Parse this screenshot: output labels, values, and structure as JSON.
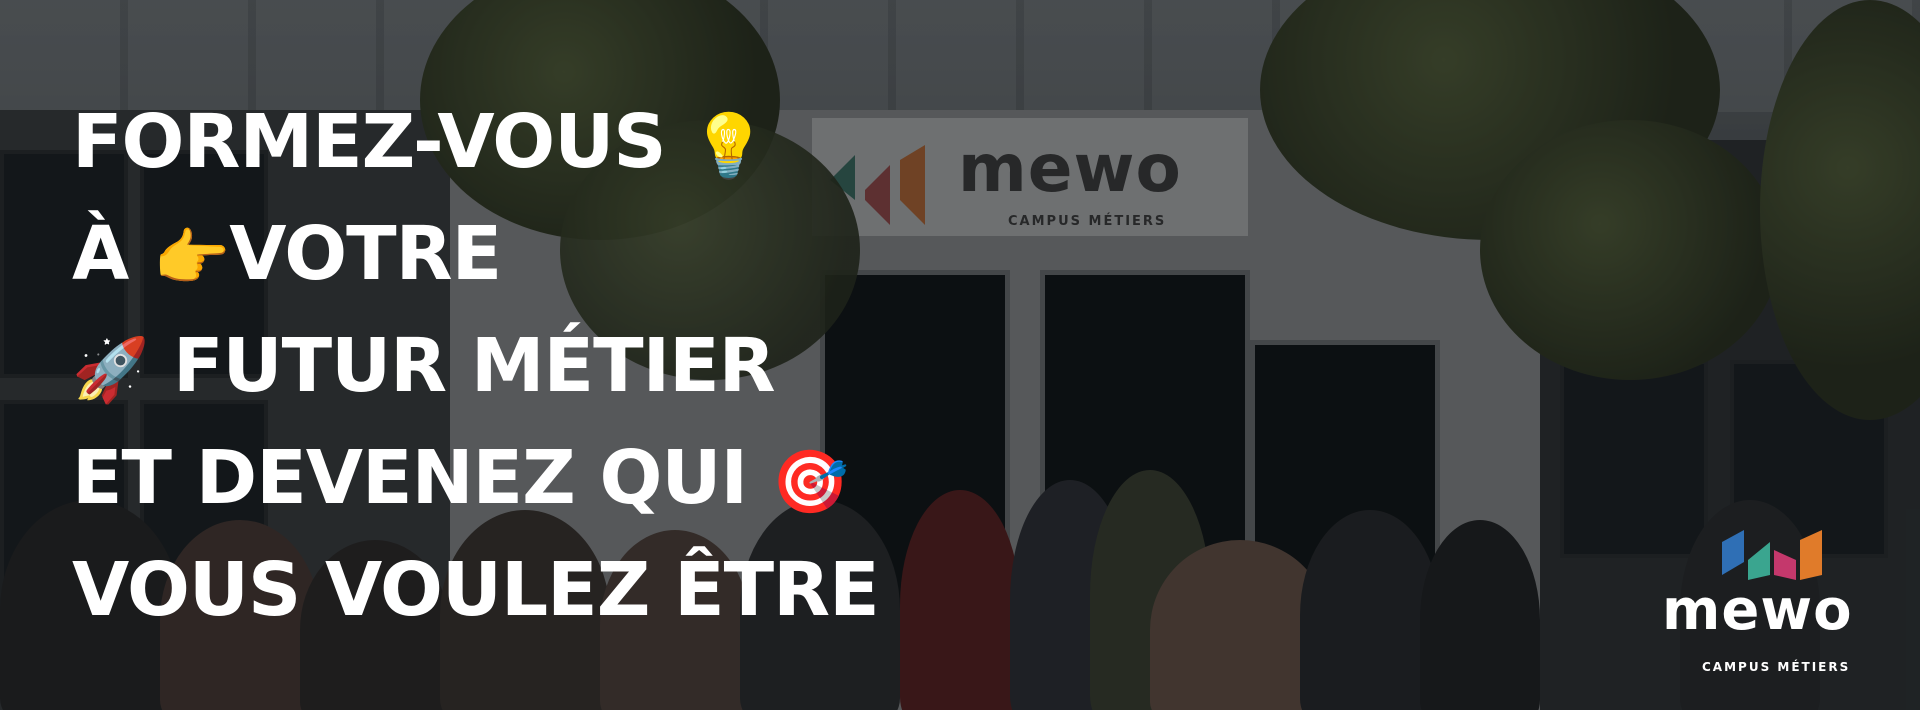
{
  "banner": {
    "headline_lines": [
      {
        "text": "FORMEZ-VOUS",
        "emoji": "💡"
      },
      {
        "prefix": "À",
        "emoji": "👉",
        "text": "VOTRE"
      },
      {
        "emoji": "🚀",
        "text": "FUTUR MÉTIER"
      },
      {
        "text": "ET DEVENEZ QUI",
        "emoji": "🎯"
      },
      {
        "text": "VOUS VOULEZ ÊTRE"
      }
    ]
  },
  "building_sign": {
    "wordmark": "mewo",
    "subtitle": "CAMPUS MÉTIERS"
  },
  "brand_logo": {
    "wordmark": "mewo",
    "subtitle": "CAMPUS MÉTIERS",
    "colors": {
      "blue": "#2f6fb5",
      "teal": "#3aa58f",
      "pink": "#c4386c",
      "orange": "#e07b2a"
    }
  },
  "colors": {
    "headline_text": "#ffffff"
  }
}
